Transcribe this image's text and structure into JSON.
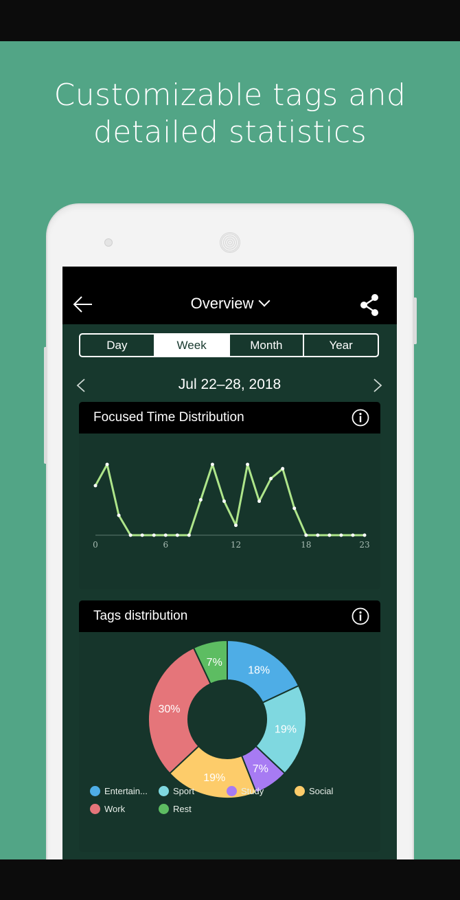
{
  "promo": {
    "headline_line1": "Customizable tags and",
    "headline_line2": "detailed statistics",
    "background_color": "#52a586"
  },
  "app_bar": {
    "title": "Overview",
    "back_icon": "arrow-left-icon",
    "dropdown_icon": "chevron-down-icon",
    "share_icon": "share-icon"
  },
  "period_tabs": [
    {
      "label": "Day",
      "active": false
    },
    {
      "label": "Week",
      "active": true
    },
    {
      "label": "Month",
      "active": false
    },
    {
      "label": "Year",
      "active": false
    }
  ],
  "date_range": "Jul 22–28, 2018",
  "focused_card": {
    "title": "Focused Time Distribution"
  },
  "tags_card": {
    "title": "Tags distribution"
  },
  "chart_data": [
    {
      "type": "line",
      "title": "Focused Time Distribution",
      "x_ticks": [
        "0",
        "6",
        "12",
        "18",
        "23"
      ],
      "x": [
        0,
        1,
        2,
        3,
        4,
        5,
        6,
        7,
        8,
        9,
        10,
        11,
        12,
        13,
        14,
        15,
        16,
        17,
        18,
        19,
        20,
        21,
        22,
        23
      ],
      "values": [
        0.7,
        1.0,
        0.28,
        0,
        0,
        0,
        0,
        0,
        0,
        0.5,
        1.0,
        0.48,
        0.14,
        1.0,
        0.48,
        0.8,
        0.94,
        0.38,
        0,
        0,
        0,
        0,
        0,
        0
      ],
      "xlim": [
        0,
        23
      ],
      "ylim": [
        0,
        1.1
      ],
      "grid": false,
      "line_color": "#aee58a"
    },
    {
      "type": "pie",
      "title": "Tags distribution",
      "donut": true,
      "slices": [
        {
          "label": "Entertain...",
          "value": 18,
          "text": "18%",
          "color": "#4eade6"
        },
        {
          "label": "Sport",
          "value": 19,
          "text": "19%",
          "color": "#7fd8e0"
        },
        {
          "label": "Study",
          "value": 7,
          "text": "7%",
          "color": "#a77bf3"
        },
        {
          "label": "Social",
          "value": 19,
          "text": "19%",
          "color": "#fdcc6a"
        },
        {
          "label": "Work",
          "value": 30,
          "text": "30%",
          "color": "#e5757a"
        },
        {
          "label": "Rest",
          "value": 7,
          "text": "7%",
          "color": "#5dbd62"
        }
      ],
      "legend_position": "bottom"
    }
  ]
}
